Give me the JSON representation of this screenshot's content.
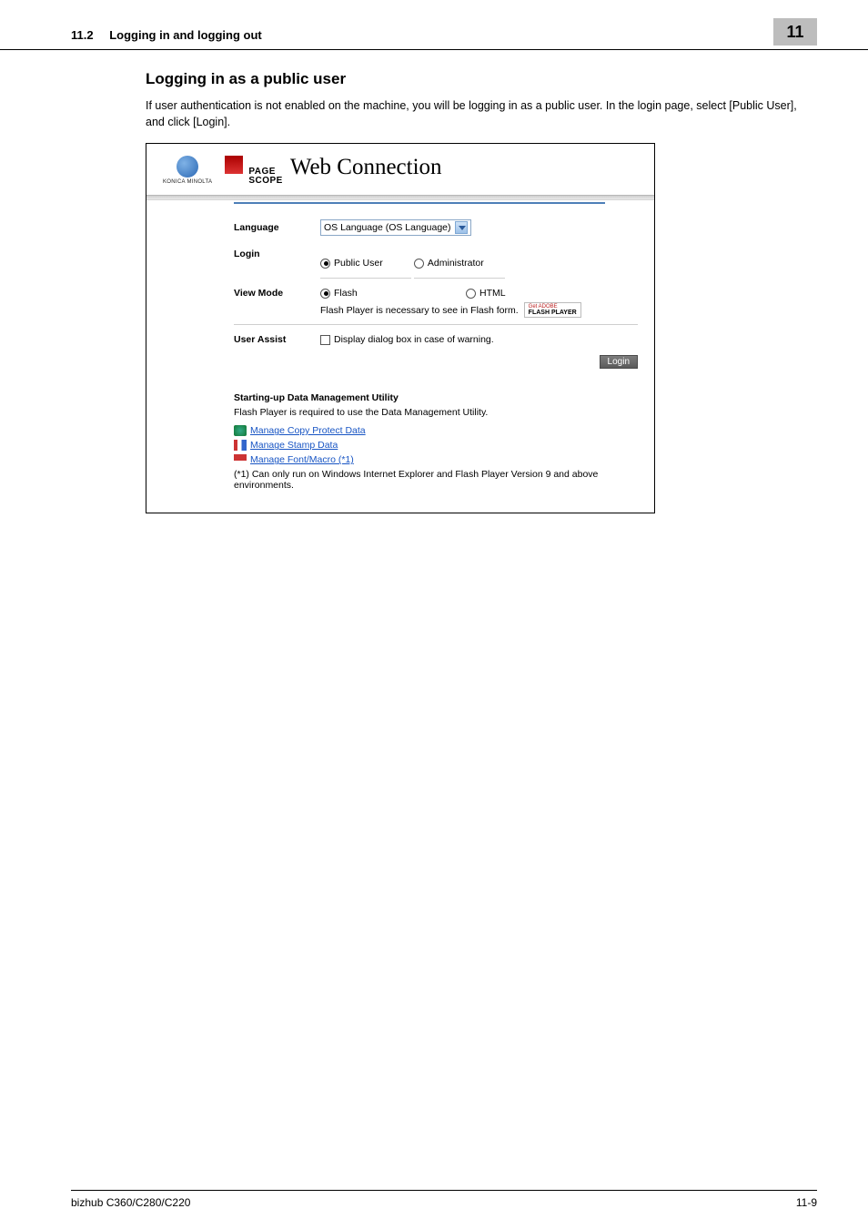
{
  "header": {
    "section_number": "11.2",
    "section_title": "Logging in and logging out",
    "chapter_number": "11"
  },
  "content": {
    "subheading": "Logging in as a public user",
    "paragraph": "If user authentication is not enabled on the machine, you will be logging in as a public user. In the login page, select [Public User], and click [Login]."
  },
  "screenshot": {
    "brand_small": "KONICA MINOLTA",
    "pagescope_line1": "PAGE",
    "pagescope_line2": "SCOPE",
    "title": "Web Connection",
    "form": {
      "language_label": "Language",
      "language_value": "OS Language (OS Language)",
      "login_label": "Login",
      "login_public": "Public User",
      "login_admin": "Administrator",
      "view_mode_label": "View Mode",
      "view_flash": "Flash",
      "view_html": "HTML",
      "flash_note": "Flash Player is necessary to see in Flash form.",
      "adobe_top": "Get ADOBE",
      "adobe_bot": "FLASH PLAYER",
      "user_assist_label": "User Assist",
      "user_assist_text": "Display dialog box in case of warning.",
      "login_button": "Login"
    },
    "utility": {
      "title": "Starting-up Data Management Utility",
      "desc": "Flash Player is required to use the Data Management Utility.",
      "link1": "Manage Copy Protect Data",
      "link2": "Manage Stamp Data",
      "link3": "Manage Font/Macro (*1)",
      "note": "(*1) Can only run on Windows Internet Explorer and Flash Player Version 9 and above environments."
    }
  },
  "footer": {
    "model": "bizhub C360/C280/C220",
    "page_number": "11-9"
  }
}
